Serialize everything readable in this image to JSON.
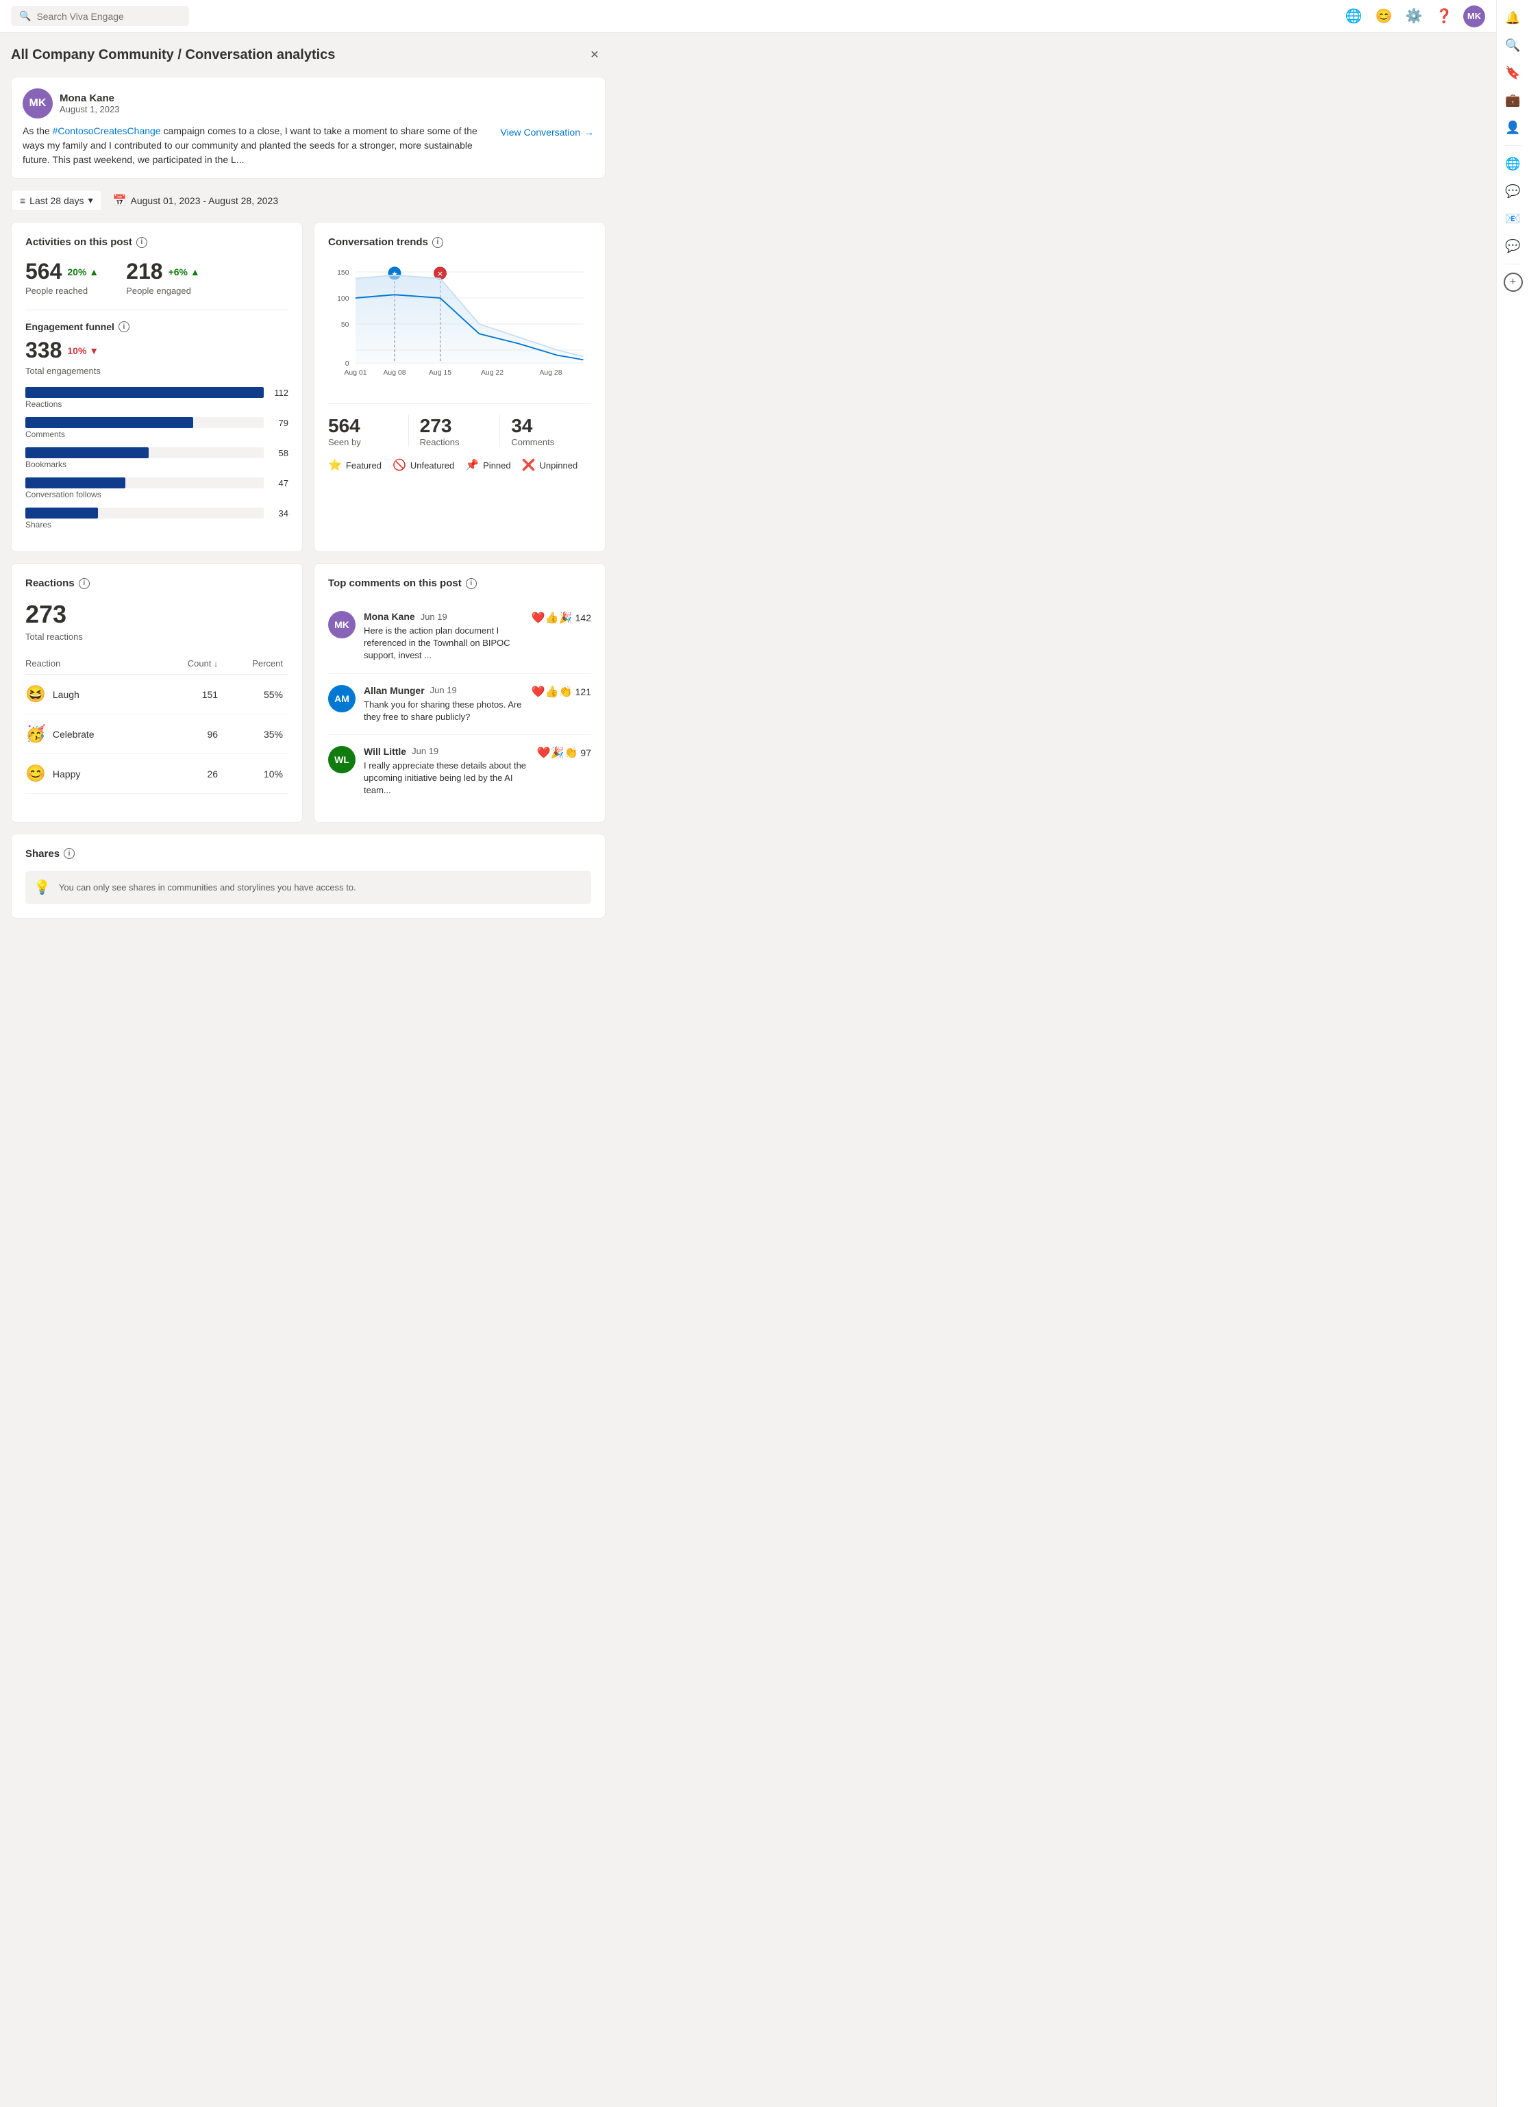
{
  "app": {
    "title": "All Company Community / Conversation analytics",
    "search_placeholder": "Search Viva Engage"
  },
  "post": {
    "author": "Mona Kane",
    "author_initials": "MK",
    "date": "August 1, 2023",
    "text_prefix": "As the ",
    "hashtag": "#ContosoCreatesChange",
    "text_suffix": " campaign comes to a close, I want to take a moment to share some of the ways my family and I contributed to our community and planted the seeds for a stronger, more sustainable future. This past weekend, we participated in the L...",
    "view_conversation_label": "View Conversation"
  },
  "filter": {
    "period_label": "Last 28 days",
    "date_range": "August 01, 2023 - August 28, 2023"
  },
  "activities": {
    "title": "Activities on this post",
    "people_reached_value": "564",
    "people_reached_change": "20%",
    "people_reached_label": "People reached",
    "people_engaged_value": "218",
    "people_engaged_change": "+6%",
    "people_engaged_label": "People engaged",
    "funnel_title": "Engagement funnel",
    "total_engagements_value": "338",
    "total_engagements_change": "10%",
    "total_engagements_label": "Total engagements",
    "bars": [
      {
        "name": "Reactions",
        "value": 112,
        "max": 112,
        "label": "112"
      },
      {
        "name": "Comments",
        "value": 79,
        "max": 112,
        "label": "79"
      },
      {
        "name": "Bookmarks",
        "value": 58,
        "max": 112,
        "label": "58"
      },
      {
        "name": "Conversation follows",
        "value": 47,
        "max": 112,
        "label": "47"
      },
      {
        "name": "Shares",
        "value": 34,
        "max": 112,
        "label": "34"
      }
    ]
  },
  "trends": {
    "title": "Conversation trends",
    "x_labels": [
      "Aug 01",
      "Aug 08",
      "Aug 15",
      "Aug 22",
      "Aug 28"
    ],
    "y_labels": [
      "0",
      "50",
      "100",
      "150"
    ],
    "seen_by_value": "564",
    "seen_by_label": "Seen by",
    "reactions_value": "273",
    "reactions_label": "Reactions",
    "comments_value": "34",
    "comments_label": "Comments",
    "legend": [
      {
        "icon": "⭐",
        "label": "Featured",
        "color": "#0078d4"
      },
      {
        "icon": "🚫",
        "label": "Unfeatured",
        "color": "#605e5c"
      },
      {
        "icon": "📌",
        "label": "Pinned",
        "color": "#d83b01"
      },
      {
        "icon": "❌",
        "label": "Unpinned",
        "color": "#d83b01"
      }
    ]
  },
  "reactions": {
    "title": "Reactions",
    "total_value": "273",
    "total_label": "Total reactions",
    "column_reaction": "Reaction",
    "column_count": "Count",
    "column_percent": "Percent",
    "items": [
      {
        "emoji": "😆",
        "name": "Laugh",
        "count": "151",
        "percent": "55%"
      },
      {
        "emoji": "🥳",
        "name": "Celebrate",
        "count": "96",
        "percent": "35%"
      },
      {
        "emoji": "😊",
        "name": "Happy",
        "count": "26",
        "percent": "10%"
      }
    ]
  },
  "top_comments": {
    "title": "Top comments on this post",
    "items": [
      {
        "author": "Mona Kane",
        "initials": "MK",
        "date": "Jun 19",
        "text": "Here is the action plan document I referenced in the Townhall on BIPOC support, invest ...",
        "reactions": "❤️👍🎉",
        "count": "142",
        "avatar_color": "#8764b8"
      },
      {
        "author": "Allan Munger",
        "initials": "AM",
        "date": "Jun 19",
        "text": "Thank you for sharing these photos. Are they free to share publicly?",
        "reactions": "❤️👍👏",
        "count": "121",
        "avatar_color": "#0078d4"
      },
      {
        "author": "Will Little",
        "initials": "WL",
        "date": "Jun 19",
        "text": "I really appreciate these details about the upcoming initiative being led by the AI team...",
        "reactions": "❤️🎉👏",
        "count": "97",
        "avatar_color": "#107c10"
      }
    ]
  },
  "shares": {
    "title": "Shares",
    "notice": "You can only see shares in communities and storylines you have access to."
  },
  "sidebar": {
    "icons": [
      {
        "name": "notifications-icon",
        "symbol": "🔔",
        "active": true
      },
      {
        "name": "search-icon",
        "symbol": "🔍",
        "active": false
      },
      {
        "name": "bookmark-icon",
        "symbol": "🔖",
        "active": false
      },
      {
        "name": "briefcase-icon",
        "symbol": "💼",
        "active": false
      },
      {
        "name": "people-icon",
        "symbol": "👤",
        "active": false
      },
      {
        "name": "globe-icon",
        "symbol": "🌐",
        "active": false
      },
      {
        "name": "chat-icon",
        "symbol": "💬",
        "active": false
      }
    ]
  }
}
